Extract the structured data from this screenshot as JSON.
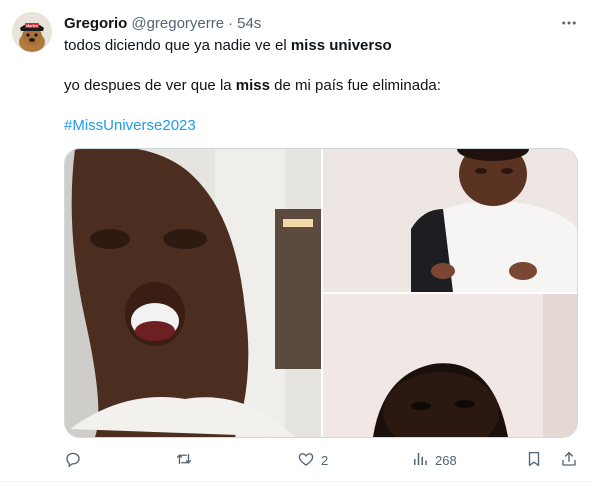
{
  "author": {
    "display_name": "Gregorio",
    "handle": "@gregoryerre",
    "separator": "·",
    "time": "54s",
    "avatar_badge": "Martini"
  },
  "tweet": {
    "line1_pre": "todos diciendo que ya nadie ve el ",
    "line1_bold": "miss universo",
    "line2_pre": "yo despues de ver que la ",
    "line2_bold": "miss",
    "line2_post": " de mi país fue eliminada:",
    "hashtag": "#MissUniverse2023"
  },
  "actions": {
    "replies": "",
    "retweets": "",
    "likes": "2",
    "views": "268"
  },
  "icons": {
    "reply": "reply-icon",
    "retweet": "retweet-icon",
    "like": "heart-icon",
    "views": "views-icon",
    "bookmark": "bookmark-icon",
    "share": "share-icon",
    "more": "more-icon"
  },
  "colors": {
    "text": "#0f1419",
    "secondary": "#536471",
    "link": "#1d9bf0",
    "border": "#cfd9de"
  }
}
